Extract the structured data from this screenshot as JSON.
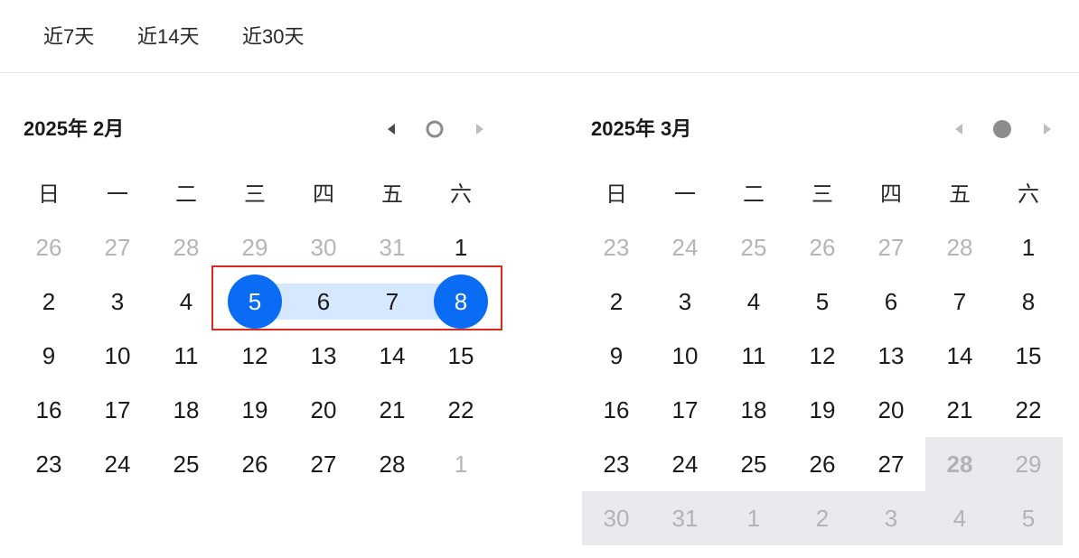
{
  "shortcuts": [
    {
      "label": "近7天"
    },
    {
      "label": "近14天"
    },
    {
      "label": "近30天"
    }
  ],
  "weekdays": [
    "日",
    "一",
    "二",
    "三",
    "四",
    "五",
    "六"
  ],
  "colors": {
    "selected": "#0a6cf5",
    "range": "#d6e8ff",
    "disabled": "#e8eaee",
    "highlight_border": "#d9281e"
  },
  "left_panel": {
    "title": "2025年 2月",
    "icons": [
      "caret-left-icon",
      "ring-icon",
      "caret-right-icon"
    ],
    "days": [
      {
        "n": "26",
        "t": "other"
      },
      {
        "n": "27",
        "t": "other"
      },
      {
        "n": "28",
        "t": "other"
      },
      {
        "n": "29",
        "t": "other"
      },
      {
        "n": "30",
        "t": "other"
      },
      {
        "n": "31",
        "t": "other"
      },
      {
        "n": "1",
        "t": "normal"
      },
      {
        "n": "2",
        "t": "normal"
      },
      {
        "n": "3",
        "t": "normal"
      },
      {
        "n": "4",
        "t": "normal"
      },
      {
        "n": "5",
        "t": "range-start"
      },
      {
        "n": "6",
        "t": "inrange"
      },
      {
        "n": "7",
        "t": "inrange"
      },
      {
        "n": "8",
        "t": "range-end"
      },
      {
        "n": "9",
        "t": "normal"
      },
      {
        "n": "10",
        "t": "normal"
      },
      {
        "n": "11",
        "t": "normal"
      },
      {
        "n": "12",
        "t": "normal"
      },
      {
        "n": "13",
        "t": "normal"
      },
      {
        "n": "14",
        "t": "normal"
      },
      {
        "n": "15",
        "t": "normal"
      },
      {
        "n": "16",
        "t": "normal"
      },
      {
        "n": "17",
        "t": "normal"
      },
      {
        "n": "18",
        "t": "normal"
      },
      {
        "n": "19",
        "t": "normal"
      },
      {
        "n": "20",
        "t": "normal"
      },
      {
        "n": "21",
        "t": "normal"
      },
      {
        "n": "22",
        "t": "normal"
      },
      {
        "n": "23",
        "t": "normal"
      },
      {
        "n": "24",
        "t": "normal"
      },
      {
        "n": "25",
        "t": "normal"
      },
      {
        "n": "26",
        "t": "normal"
      },
      {
        "n": "27",
        "t": "normal"
      },
      {
        "n": "28",
        "t": "normal"
      },
      {
        "n": "1",
        "t": "other"
      }
    ]
  },
  "right_panel": {
    "title": "2025年 3月",
    "icons": [
      "caret-left-icon",
      "dot-icon",
      "caret-right-icon"
    ],
    "days": [
      {
        "n": "23",
        "t": "other"
      },
      {
        "n": "24",
        "t": "other"
      },
      {
        "n": "25",
        "t": "other"
      },
      {
        "n": "26",
        "t": "other"
      },
      {
        "n": "27",
        "t": "other"
      },
      {
        "n": "28",
        "t": "other"
      },
      {
        "n": "1",
        "t": "normal"
      },
      {
        "n": "2",
        "t": "normal"
      },
      {
        "n": "3",
        "t": "normal"
      },
      {
        "n": "4",
        "t": "normal"
      },
      {
        "n": "5",
        "t": "normal"
      },
      {
        "n": "6",
        "t": "normal"
      },
      {
        "n": "7",
        "t": "normal"
      },
      {
        "n": "8",
        "t": "normal"
      },
      {
        "n": "9",
        "t": "normal"
      },
      {
        "n": "10",
        "t": "normal"
      },
      {
        "n": "11",
        "t": "normal"
      },
      {
        "n": "12",
        "t": "normal"
      },
      {
        "n": "13",
        "t": "normal"
      },
      {
        "n": "14",
        "t": "normal"
      },
      {
        "n": "15",
        "t": "normal"
      },
      {
        "n": "16",
        "t": "normal"
      },
      {
        "n": "17",
        "t": "normal"
      },
      {
        "n": "18",
        "t": "normal"
      },
      {
        "n": "19",
        "t": "normal"
      },
      {
        "n": "20",
        "t": "normal"
      },
      {
        "n": "21",
        "t": "normal"
      },
      {
        "n": "22",
        "t": "normal"
      },
      {
        "n": "23",
        "t": "normal"
      },
      {
        "n": "24",
        "t": "normal"
      },
      {
        "n": "25",
        "t": "normal"
      },
      {
        "n": "26",
        "t": "normal"
      },
      {
        "n": "27",
        "t": "normal"
      },
      {
        "n": "28",
        "t": "disabled-today"
      },
      {
        "n": "29",
        "t": "disabled"
      },
      {
        "n": "30",
        "t": "disabled"
      },
      {
        "n": "31",
        "t": "disabled"
      },
      {
        "n": "1",
        "t": "disabled"
      },
      {
        "n": "2",
        "t": "disabled"
      },
      {
        "n": "3",
        "t": "disabled"
      },
      {
        "n": "4",
        "t": "disabled"
      },
      {
        "n": "5",
        "t": "disabled"
      }
    ]
  }
}
